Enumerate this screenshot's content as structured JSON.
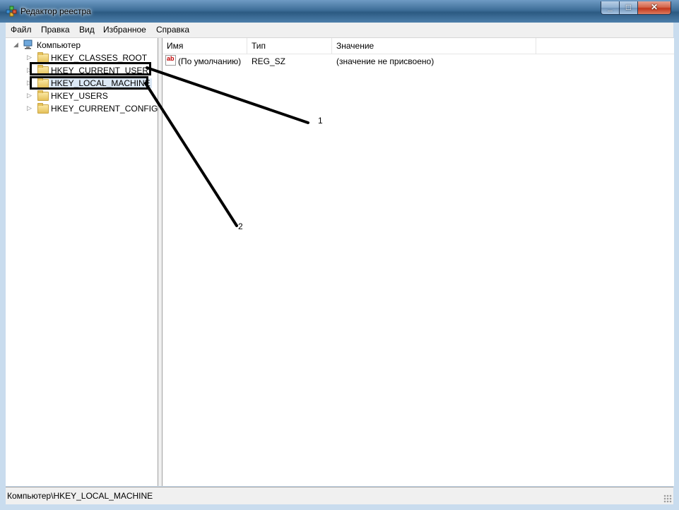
{
  "window": {
    "title": "Редактор реестра",
    "app_icon": "regedit-icon",
    "controls": {
      "minimize": "minimize-icon",
      "maximize": "maximize-icon",
      "close": "close-icon"
    }
  },
  "menu": [
    "Файл",
    "Правка",
    "Вид",
    "Избранное",
    "Справка"
  ],
  "tree": {
    "root": {
      "label": "Компьютер",
      "icon": "computer-icon",
      "expanded": true
    },
    "items": [
      {
        "label": "HKEY_CLASSES_ROOT",
        "icon": "folder-icon"
      },
      {
        "label": "HKEY_CURRENT_USER",
        "icon": "folder-icon"
      },
      {
        "label": "HKEY_LOCAL_MACHINE",
        "icon": "folder-icon",
        "selected": true
      },
      {
        "label": "HKEY_USERS",
        "icon": "folder-icon"
      },
      {
        "label": "HKEY_CURRENT_CONFIG",
        "icon": "folder-icon"
      }
    ]
  },
  "list": {
    "columns": [
      "Имя",
      "Тип",
      "Значение"
    ],
    "rows": [
      {
        "name": "(По умолчанию)",
        "type": "REG_SZ",
        "value": "(значение не присвоено)",
        "icon": "string-value-icon"
      }
    ]
  },
  "status": "Компьютер\\HKEY_LOCAL_MACHINE",
  "annotations": {
    "label_1": "1",
    "label_2": "2"
  }
}
